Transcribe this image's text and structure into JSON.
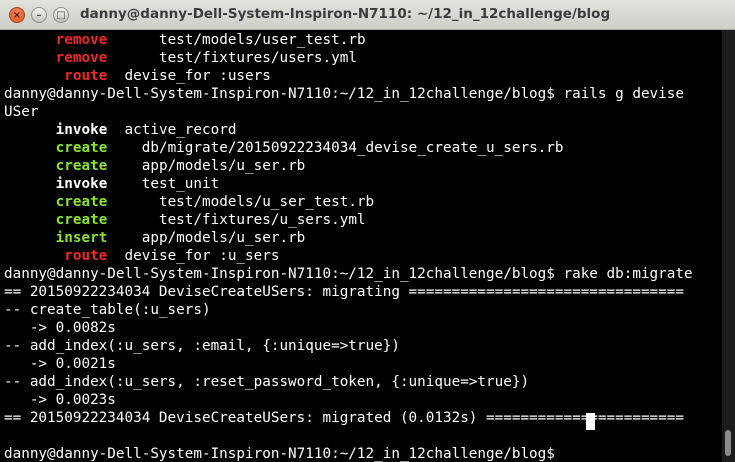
{
  "window": {
    "title": "danny@danny-Dell-System-Inspiron-N7110: ~/12_in_12challenge/blog",
    "buttons": {
      "close_icon": "×",
      "minimize_icon": "–",
      "maximize_icon": "□"
    }
  },
  "terminal": {
    "lines": [
      {
        "indent": "      ",
        "status": "remove",
        "gap": "      ",
        "text": "test/models/user_test.rb"
      },
      {
        "indent": "      ",
        "status": "remove",
        "gap": "      ",
        "text": "test/fixtures/users.yml"
      },
      {
        "indent": "       ",
        "status": "route",
        "gap": "  ",
        "text": "devise_for :users"
      },
      {
        "text": "danny@danny-Dell-System-Inspiron-N7110:~/12_in_12challenge/blog$ rails g devise"
      },
      {
        "text": "USer"
      },
      {
        "indent": "      ",
        "status": "invoke",
        "gap": "  ",
        "text": "active_record"
      },
      {
        "indent": "      ",
        "status": "create",
        "gap": "    ",
        "text": "db/migrate/20150922234034_devise_create_u_sers.rb"
      },
      {
        "indent": "      ",
        "status": "create",
        "gap": "    ",
        "text": "app/models/u_ser.rb"
      },
      {
        "indent": "      ",
        "status": "invoke",
        "gap": "    ",
        "text": "test_unit"
      },
      {
        "indent": "      ",
        "status": "create",
        "gap": "      ",
        "text": "test/models/u_ser_test.rb"
      },
      {
        "indent": "      ",
        "status": "create",
        "gap": "      ",
        "text": "test/fixtures/u_sers.yml"
      },
      {
        "indent": "      ",
        "status": "insert",
        "gap": "    ",
        "text": "app/models/u_ser.rb"
      },
      {
        "indent": "       ",
        "status": "route",
        "gap": "  ",
        "text": "devise_for :u_sers"
      },
      {
        "text": "danny@danny-Dell-System-Inspiron-N7110:~/12_in_12challenge/blog$ rake db:migrate"
      },
      {
        "text": "== 20150922234034 DeviseCreateUSers: migrating ================================"
      },
      {
        "text": "-- create_table(:u_sers)"
      },
      {
        "text": "   -> 0.0082s"
      },
      {
        "text": "-- add_index(:u_sers, :email, {:unique=>true})"
      },
      {
        "text": "   -> 0.0021s"
      },
      {
        "text": "-- add_index(:u_sers, :reset_password_token, {:unique=>true})"
      },
      {
        "text": "   -> 0.0023s"
      },
      {
        "text": "== 20150922234034 DeviseCreateUSers: migrated (0.0132s) ======================="
      },
      {
        "text": ""
      },
      {
        "text": "danny@danny-Dell-System-Inspiron-N7110:~/12_in_12challenge/blog$ "
      }
    ],
    "status_colors": {
      "remove": "#ef2929",
      "route": "#ef2929",
      "invoke": "#ffffff",
      "create": "#8ae234",
      "insert": "#8ae234"
    },
    "background": "#000000",
    "foreground": "#ffffff"
  }
}
